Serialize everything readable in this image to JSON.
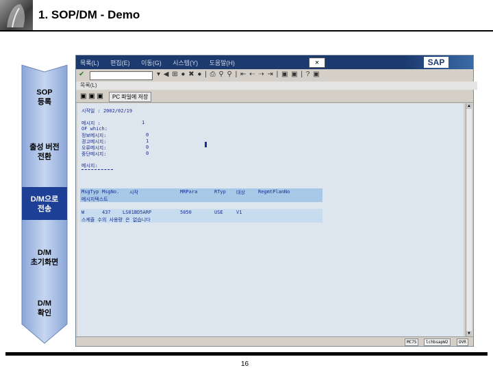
{
  "slide": {
    "title": "1. SOP/DM - Demo",
    "page_number": "16"
  },
  "process_steps": [
    {
      "label": "SOP\n등록",
      "active": false
    },
    {
      "label": "출성 버전\n전환",
      "active": false
    },
    {
      "label": "D/M으로\n전송",
      "active": true
    },
    {
      "label": "D/M\n초기화면",
      "active": false
    },
    {
      "label": "D/M\n확인",
      "active": false
    }
  ],
  "sap": {
    "menu": [
      "목록(L)",
      "편집(E)",
      "이동(G)",
      "시스템(Y)",
      "도움말(H)"
    ],
    "logo": "SAP",
    "title_row": "목록(L)",
    "app_button": "PC 파일에 저장",
    "content_lines": [
      "시작일 : 2002/02/19",
      "메시지 :",
      "OF which:",
      "정보메시지:",
      "경고메시지:",
      "오류메시지:",
      "중단메시지:",
      "메시지:"
    ],
    "content_values": [
      "1",
      "0",
      "1",
      "0",
      "0"
    ],
    "table_header": [
      "MsgTyp",
      "MsgNo.",
      "시작",
      "MRPara",
      "RTyp",
      "대상",
      "RegmtPlanNo"
    ],
    "table_subheader": "메시지텍스트",
    "table_row": [
      "W",
      "437",
      "LS01BD5ARP",
      "5050",
      "USE",
      "V1"
    ],
    "table_row_text": "스케쥴 수의 사용량 은 없습니다",
    "status": [
      "MC75",
      "lchbsapW2",
      "OVR"
    ]
  }
}
